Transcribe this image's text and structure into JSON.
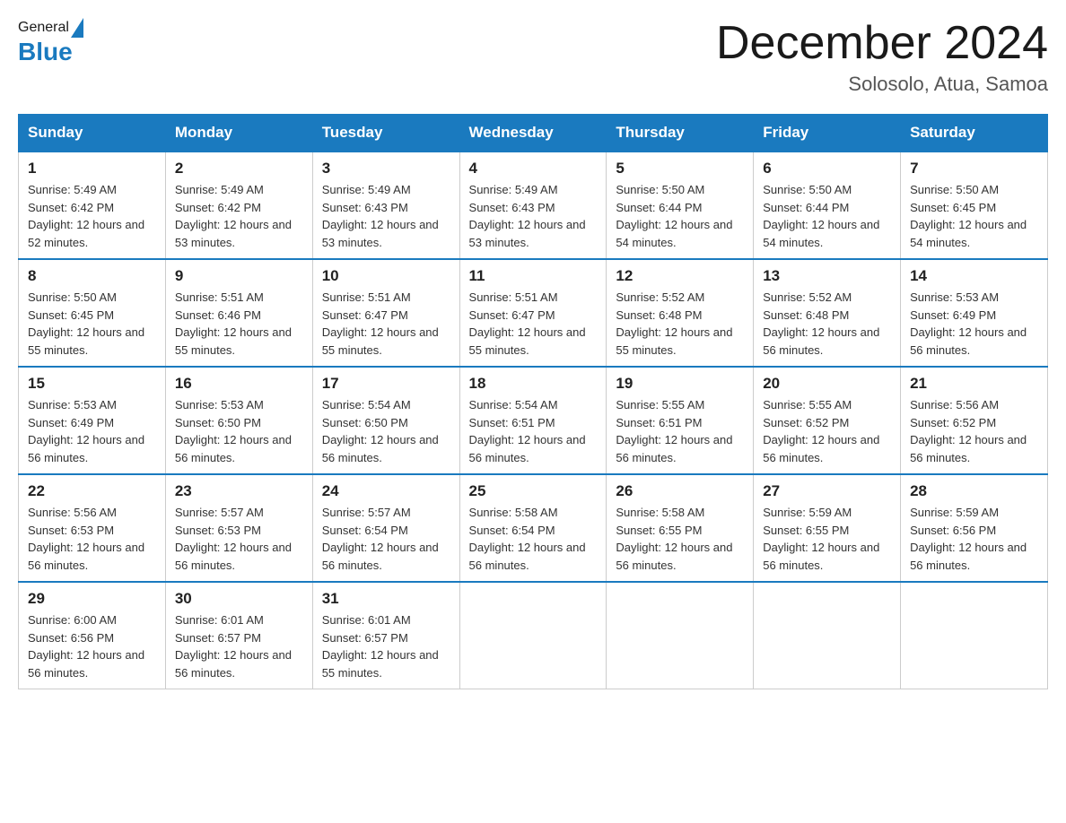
{
  "header": {
    "logo_general": "General",
    "logo_blue": "Blue",
    "month_title": "December 2024",
    "location": "Solosolo, Atua, Samoa"
  },
  "days_of_week": [
    "Sunday",
    "Monday",
    "Tuesday",
    "Wednesday",
    "Thursday",
    "Friday",
    "Saturday"
  ],
  "weeks": [
    [
      {
        "day": "1",
        "sunrise": "5:49 AM",
        "sunset": "6:42 PM",
        "daylight": "12 hours and 52 minutes."
      },
      {
        "day": "2",
        "sunrise": "5:49 AM",
        "sunset": "6:42 PM",
        "daylight": "12 hours and 53 minutes."
      },
      {
        "day": "3",
        "sunrise": "5:49 AM",
        "sunset": "6:43 PM",
        "daylight": "12 hours and 53 minutes."
      },
      {
        "day": "4",
        "sunrise": "5:49 AM",
        "sunset": "6:43 PM",
        "daylight": "12 hours and 53 minutes."
      },
      {
        "day": "5",
        "sunrise": "5:50 AM",
        "sunset": "6:44 PM",
        "daylight": "12 hours and 54 minutes."
      },
      {
        "day": "6",
        "sunrise": "5:50 AM",
        "sunset": "6:44 PM",
        "daylight": "12 hours and 54 minutes."
      },
      {
        "day": "7",
        "sunrise": "5:50 AM",
        "sunset": "6:45 PM",
        "daylight": "12 hours and 54 minutes."
      }
    ],
    [
      {
        "day": "8",
        "sunrise": "5:50 AM",
        "sunset": "6:45 PM",
        "daylight": "12 hours and 55 minutes."
      },
      {
        "day": "9",
        "sunrise": "5:51 AM",
        "sunset": "6:46 PM",
        "daylight": "12 hours and 55 minutes."
      },
      {
        "day": "10",
        "sunrise": "5:51 AM",
        "sunset": "6:47 PM",
        "daylight": "12 hours and 55 minutes."
      },
      {
        "day": "11",
        "sunrise": "5:51 AM",
        "sunset": "6:47 PM",
        "daylight": "12 hours and 55 minutes."
      },
      {
        "day": "12",
        "sunrise": "5:52 AM",
        "sunset": "6:48 PM",
        "daylight": "12 hours and 55 minutes."
      },
      {
        "day": "13",
        "sunrise": "5:52 AM",
        "sunset": "6:48 PM",
        "daylight": "12 hours and 56 minutes."
      },
      {
        "day": "14",
        "sunrise": "5:53 AM",
        "sunset": "6:49 PM",
        "daylight": "12 hours and 56 minutes."
      }
    ],
    [
      {
        "day": "15",
        "sunrise": "5:53 AM",
        "sunset": "6:49 PM",
        "daylight": "12 hours and 56 minutes."
      },
      {
        "day": "16",
        "sunrise": "5:53 AM",
        "sunset": "6:50 PM",
        "daylight": "12 hours and 56 minutes."
      },
      {
        "day": "17",
        "sunrise": "5:54 AM",
        "sunset": "6:50 PM",
        "daylight": "12 hours and 56 minutes."
      },
      {
        "day": "18",
        "sunrise": "5:54 AM",
        "sunset": "6:51 PM",
        "daylight": "12 hours and 56 minutes."
      },
      {
        "day": "19",
        "sunrise": "5:55 AM",
        "sunset": "6:51 PM",
        "daylight": "12 hours and 56 minutes."
      },
      {
        "day": "20",
        "sunrise": "5:55 AM",
        "sunset": "6:52 PM",
        "daylight": "12 hours and 56 minutes."
      },
      {
        "day": "21",
        "sunrise": "5:56 AM",
        "sunset": "6:52 PM",
        "daylight": "12 hours and 56 minutes."
      }
    ],
    [
      {
        "day": "22",
        "sunrise": "5:56 AM",
        "sunset": "6:53 PM",
        "daylight": "12 hours and 56 minutes."
      },
      {
        "day": "23",
        "sunrise": "5:57 AM",
        "sunset": "6:53 PM",
        "daylight": "12 hours and 56 minutes."
      },
      {
        "day": "24",
        "sunrise": "5:57 AM",
        "sunset": "6:54 PM",
        "daylight": "12 hours and 56 minutes."
      },
      {
        "day": "25",
        "sunrise": "5:58 AM",
        "sunset": "6:54 PM",
        "daylight": "12 hours and 56 minutes."
      },
      {
        "day": "26",
        "sunrise": "5:58 AM",
        "sunset": "6:55 PM",
        "daylight": "12 hours and 56 minutes."
      },
      {
        "day": "27",
        "sunrise": "5:59 AM",
        "sunset": "6:55 PM",
        "daylight": "12 hours and 56 minutes."
      },
      {
        "day": "28",
        "sunrise": "5:59 AM",
        "sunset": "6:56 PM",
        "daylight": "12 hours and 56 minutes."
      }
    ],
    [
      {
        "day": "29",
        "sunrise": "6:00 AM",
        "sunset": "6:56 PM",
        "daylight": "12 hours and 56 minutes."
      },
      {
        "day": "30",
        "sunrise": "6:01 AM",
        "sunset": "6:57 PM",
        "daylight": "12 hours and 56 minutes."
      },
      {
        "day": "31",
        "sunrise": "6:01 AM",
        "sunset": "6:57 PM",
        "daylight": "12 hours and 55 minutes."
      },
      null,
      null,
      null,
      null
    ]
  ],
  "labels": {
    "sunrise": "Sunrise:",
    "sunset": "Sunset:",
    "daylight": "Daylight:"
  }
}
